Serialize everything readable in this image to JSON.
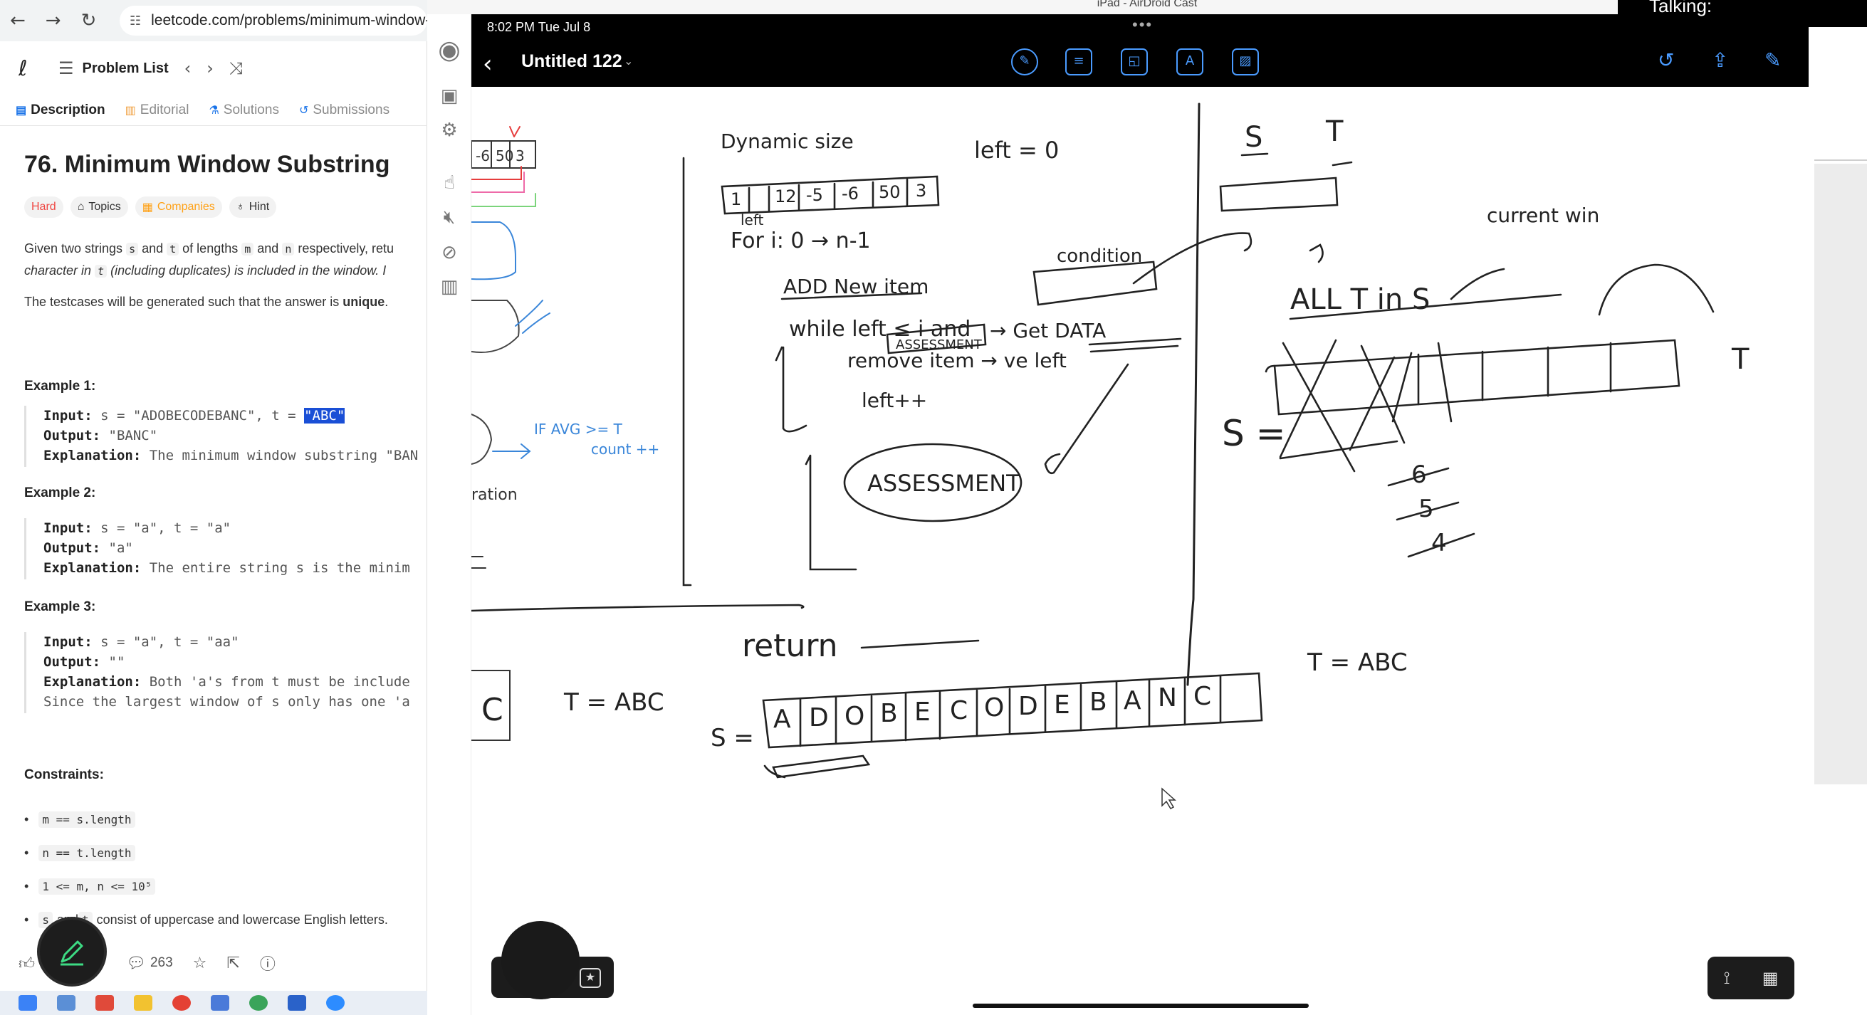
{
  "browser": {
    "url": "leetcode.com/problems/minimum-window-",
    "problem_list_label": "Problem List",
    "tabs": [
      "Description",
      "Editorial",
      "Solutions",
      "Submissions"
    ],
    "title": "76. Minimum Window Substring",
    "tags": [
      "Hard",
      "Topics",
      "Companies",
      "Hint"
    ],
    "desc_line1_a": "Given two strings ",
    "desc_s": "s",
    "desc_and": " and ",
    "desc_t": "t",
    "desc_line1_b": " of lengths ",
    "desc_m": "m",
    "desc_and2": " and ",
    "desc_n": "n",
    "desc_line1_c": " respectively, retu",
    "desc_line2_a": "character in ",
    "desc_t2": "t",
    "desc_line2_b": " (including duplicates) is included in the window. I",
    "desc_line3_a": "The testcases will be generated such that the answer is ",
    "desc_line3_b": "unique",
    "desc_line3_c": ".",
    "examples": [
      {
        "heading": "Example 1:",
        "input_label": "Input:",
        "input": " s = \"ADOBECODEBANC\", t = ",
        "input_hl": "\"ABC\"",
        "output_label": "Output:",
        "output": " \"BANC\"",
        "explanation_label": "Explanation:",
        "explanation": " The minimum window substring \"BAN"
      },
      {
        "heading": "Example 2:",
        "input_label": "Input:",
        "input": " s = \"a\", t = \"a\"",
        "output_label": "Output:",
        "output": " \"a\"",
        "explanation_label": "Explanation:",
        "explanation": " The entire string s is the minim"
      },
      {
        "heading": "Example 3:",
        "input_label": "Input:",
        "input": " s = \"a\", t = \"aa\"",
        "output_label": "Output:",
        "output": " \"\"",
        "explanation_label": "Explanation:",
        "explanation": " Both 'a's from t must be include",
        "explanation2": "Since the largest window of s only has one 'a"
      }
    ],
    "constraints_heading": "Constraints:",
    "constraints": [
      {
        "code": "m == s.length",
        "text": ""
      },
      {
        "code": "n == t.length",
        "text": ""
      },
      {
        "code": "1 <= m, n <= 10⁵",
        "text": ""
      },
      {
        "code": "s",
        "code2": "t",
        "text_mid": " and ",
        "text": " consist of uppercase and lowercase English letters."
      }
    ],
    "comments_count": "263"
  },
  "airdroid": {
    "window_title": "iPad - AirDroid Cast",
    "talking_label": "Talking:"
  },
  "ipad": {
    "status_time": "8:02 PM  Tue Jul 8",
    "doc_title": "Untitled 122"
  },
  "notes": {
    "dynamic_size": "Dynamic size",
    "left_eq_0": "left = 0",
    "array_cells": [
      "1",
      "12",
      "-5",
      "-6",
      "50",
      "3"
    ],
    "left_label": "left",
    "for_loop": "For i: 0 → n-1",
    "add_new_item": "ADD New item",
    "while_line": "while left ≤ i  and",
    "assessment_box": "ASSESSMENT",
    "get_data": "→ Get DATA",
    "condition": "condition",
    "remove_item": "remove item → ve left",
    "left_pp": "left++",
    "assessment_oval": "ASSESSMENT",
    "return": "return",
    "s_label": "S",
    "t_label": "T",
    "all_t_in_s": "ALL T in S",
    "current_win": "current win",
    "s_eq": "S =",
    "t_eq_abc": "T = ABC",
    "t_eq_abc_left": "T = ABC",
    "s_letters": [
      "A",
      "D",
      "O",
      "B",
      "E",
      "C",
      "O",
      "D",
      "E",
      "B",
      "A",
      "N",
      "C"
    ],
    "nums_654": [
      "6",
      "5",
      "4"
    ],
    "if_avg": "IF AVG >= T",
    "count_pp": "count ++",
    "ration": "ration",
    "partial_cells": [
      "-6",
      "50",
      "3"
    ]
  }
}
